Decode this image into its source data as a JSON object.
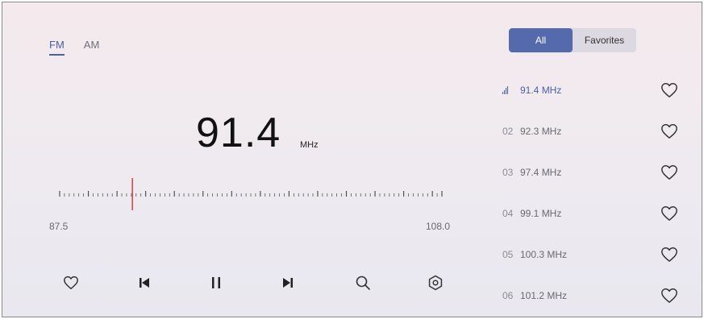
{
  "band_tabs": [
    {
      "label": "FM",
      "active": true
    },
    {
      "label": "AM",
      "active": false
    }
  ],
  "tuner": {
    "frequency": "91.4",
    "unit": "MHz",
    "scale_min": "87.5",
    "scale_max": "108.0",
    "needle_value": 91.4,
    "needle_color": "#d94040"
  },
  "controls": [
    {
      "name": "favorite",
      "icon": "heart-icon"
    },
    {
      "name": "previous",
      "icon": "skip-previous-icon"
    },
    {
      "name": "pause",
      "icon": "pause-icon"
    },
    {
      "name": "next",
      "icon": "skip-next-icon"
    },
    {
      "name": "search",
      "icon": "search-icon"
    },
    {
      "name": "settings",
      "icon": "settings-icon"
    }
  ],
  "list_toggle": {
    "all_label": "All",
    "favorites_label": "Favorites",
    "active": "all"
  },
  "stations": [
    {
      "index": "",
      "freq": "91.4  MHz",
      "playing": true
    },
    {
      "index": "02",
      "freq": "92.3  MHz",
      "playing": false
    },
    {
      "index": "03",
      "freq": "97.4  MHz",
      "playing": false
    },
    {
      "index": "04",
      "freq": "99.1  MHz",
      "playing": false
    },
    {
      "index": "05",
      "freq": "100.3 MHz",
      "playing": false
    },
    {
      "index": "06",
      "freq": "101.2 MHz",
      "playing": false
    }
  ],
  "colors": {
    "accent": "#4b5fa8",
    "toggle_active": "#5569ad",
    "needle": "#d94040"
  }
}
